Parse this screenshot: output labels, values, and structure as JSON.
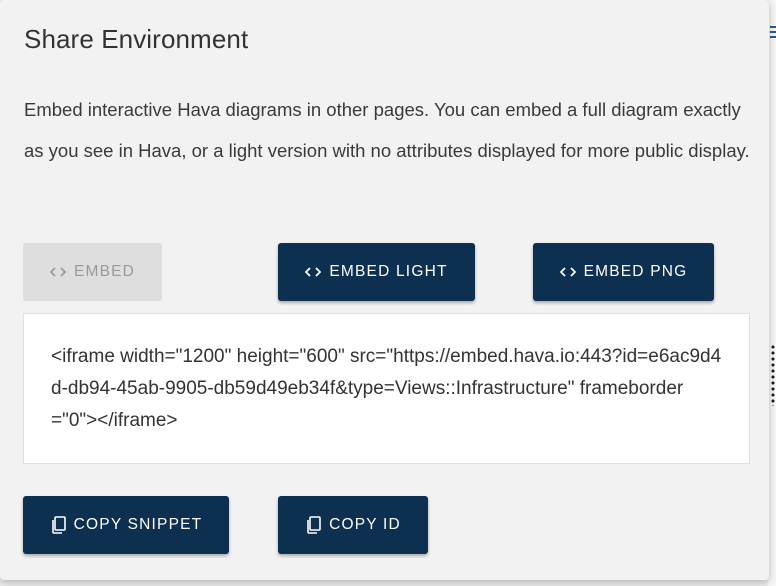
{
  "dialog": {
    "title": "Share Environment",
    "description": "Embed interactive Hava diagrams in other pages. You can embed a full diagram exactly as you see in Hava, or a light version with no attributes displayed for more public display."
  },
  "embed_options": {
    "embed": {
      "label": "EMBED",
      "icon": "code-brackets-icon",
      "state": "disabled"
    },
    "embed_light": {
      "label": "EMBED LIGHT",
      "icon": "code-brackets-icon"
    },
    "embed_png": {
      "label": "EMBED PNG",
      "icon": "code-brackets-icon"
    }
  },
  "snippet": {
    "code": "<iframe width=\"1200\" height=\"600\" src=\"https://embed.hava.io:443?id=e6ac9d4d-db94-45ab-9905-db59d49eb34f&type=Views::Infrastructure\" frameborder=\"0\"></iframe>"
  },
  "actions": {
    "copy_snippet": {
      "label": "COPY SNIPPET",
      "icon": "copy-icon"
    },
    "copy_id": {
      "label": "COPY ID",
      "icon": "copy-icon"
    }
  },
  "colors": {
    "primary_button": "#0d3051",
    "disabled_button": "#dedede",
    "dialog_background": "#f2f2f2",
    "snippet_background": "#ffffff"
  }
}
